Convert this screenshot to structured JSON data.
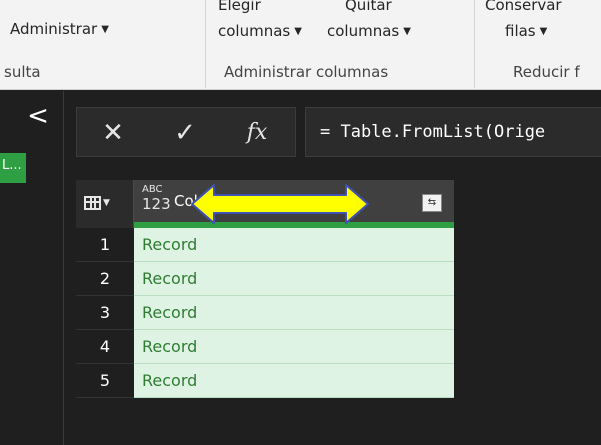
{
  "ribbon": {
    "administrar": "Administrar",
    "elegir_line1": "Elegir",
    "elegir_line2": "columnas",
    "quitar_line1": "Quitar",
    "quitar_line2": "columnas",
    "conservar_line1": "Conservar",
    "conservar_line2": "filas",
    "group_consulta": "sulta",
    "group_administrar_columnas": "Administrar columnas",
    "group_reducir": "Reducir f"
  },
  "left_pane": {
    "collapse_glyph": "<",
    "query_tab": "L..."
  },
  "formula_bar": {
    "cancel_glyph": "✕",
    "commit_glyph": "✓",
    "fx_glyph": "fx",
    "formula": "= Table.FromList(Orige"
  },
  "grid": {
    "type_icon_top": "ABC",
    "type_icon_bottom": "123",
    "column_name": "Column1",
    "expand_glyph": "⇆",
    "rows": [
      {
        "num": "1",
        "value": "Record"
      },
      {
        "num": "2",
        "value": "Record"
      },
      {
        "num": "3",
        "value": "Record"
      },
      {
        "num": "4",
        "value": "Record"
      },
      {
        "num": "5",
        "value": "Record"
      }
    ]
  },
  "colors": {
    "accent_green": "#2ea043",
    "cell_bg": "#dff3e4",
    "arrow_fill": "#ffff00",
    "arrow_stroke": "#3f51b5"
  }
}
